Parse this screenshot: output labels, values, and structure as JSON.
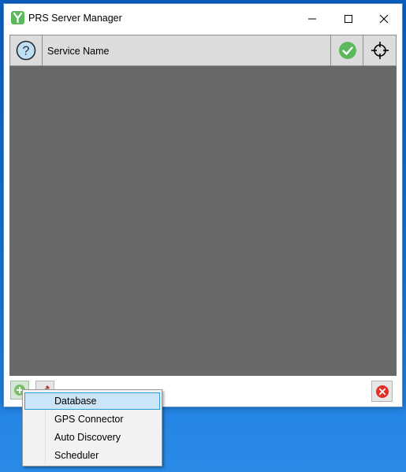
{
  "window": {
    "title": "PRS Server Manager"
  },
  "header": {
    "service_name_label": "Service Name"
  },
  "context_menu": {
    "items": [
      {
        "label": "Database",
        "selected": true
      },
      {
        "label": "GPS Connector"
      },
      {
        "label": "Auto Discovery"
      },
      {
        "label": "Scheduler"
      }
    ]
  },
  "colors": {
    "accent_green": "#5cb85c",
    "grid_background": "#696969",
    "header_background": "#dcdcdc",
    "remove_red": "#e0302a",
    "menu_highlight": "#cce4f7"
  },
  "icons": {
    "app": "app-logo-icon",
    "help": "help-icon",
    "status": "checkmark-icon",
    "locate": "crosshair-icon",
    "add": "add-icon",
    "tools": "tools-icon",
    "remove": "remove-icon"
  }
}
